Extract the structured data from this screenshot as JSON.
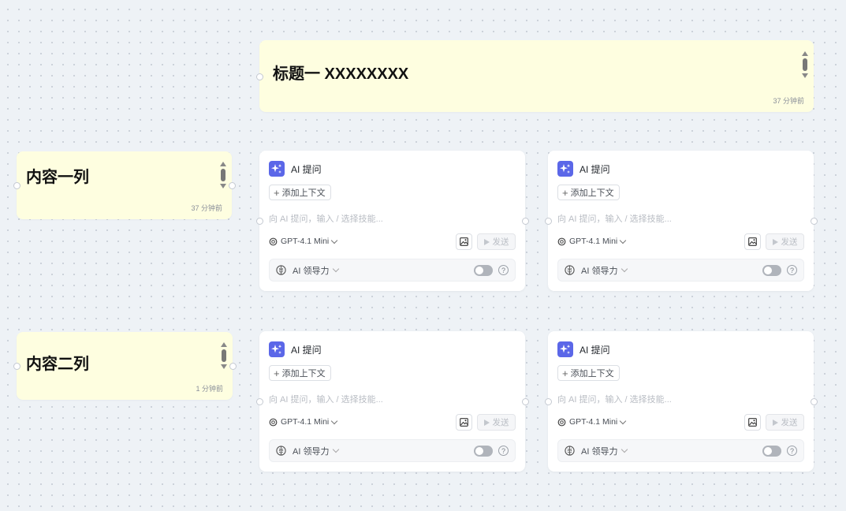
{
  "title_note": {
    "title": "标题一 XXXXXXXX",
    "time": "37 分钟前"
  },
  "row_notes": [
    {
      "title": "内容一列",
      "time": "37 分钟前"
    },
    {
      "title": "内容二列",
      "time": "1 分钟前"
    }
  ],
  "cards": [
    {
      "title": "AI 提问",
      "add_context": "添加上下文",
      "prompt_placeholder": "向 AI 提问，输入 / 选择技能...",
      "model": "GPT-4.1 Mini",
      "send": "发送",
      "leadership": "AI 领导力",
      "leadership_enabled": false
    },
    {
      "title": "AI 提问",
      "add_context": "添加上下文",
      "prompt_placeholder": "向 AI 提问，输入 / 选择技能...",
      "model": "GPT-4.1 Mini",
      "send": "发送",
      "leadership": "AI 领导力",
      "leadership_enabled": false
    },
    {
      "title": "AI 提问",
      "add_context": "添加上下文",
      "prompt_placeholder": "向 AI 提问，输入 / 选择技能...",
      "model": "GPT-4.1 Mini",
      "send": "发送",
      "leadership": "AI 领导力",
      "leadership_enabled": false
    },
    {
      "title": "AI 提问",
      "add_context": "添加上下文",
      "prompt_placeholder": "向 AI 提问，输入 / 选择技能...",
      "model": "GPT-4.1 Mini",
      "send": "发送",
      "leadership": "AI 领导力",
      "leadership_enabled": false
    }
  ],
  "colors": {
    "canvas": "#eef2f6",
    "note": "#fefee0",
    "accent": "#5b67e8"
  }
}
